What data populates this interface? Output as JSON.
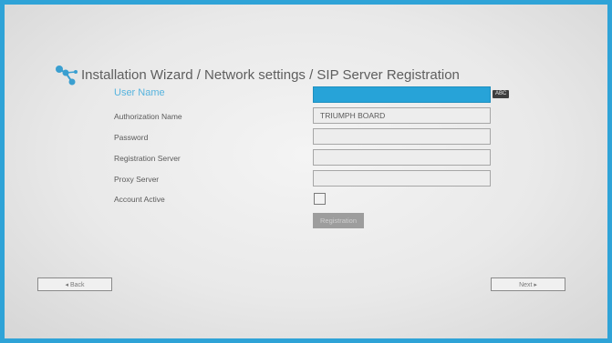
{
  "header": {
    "title": "Installation Wizard / Network settings / SIP Server Registration",
    "logo_icon": "network-nodes-icon"
  },
  "form": {
    "user_name_label": "User Name",
    "user_name_value": "",
    "authorization_name_label": "Authorization Name",
    "authorization_name_value": "TRIUMPH BOARD",
    "password_label": "Password",
    "password_value": "",
    "registration_server_label": "Registration Server",
    "registration_server_value": "",
    "proxy_server_label": "Proxy Server",
    "proxy_server_value": "",
    "account_active_label": "Account Active",
    "account_active_checked": false,
    "input_mode_badge": "ABC",
    "registration_button": "Registration"
  },
  "nav": {
    "back_label": "◂ Back",
    "next_label": "Next ▸"
  },
  "colors": {
    "frame": "#2fa3d7",
    "active_field": "#27a3d8",
    "active_label": "#56b3de"
  }
}
